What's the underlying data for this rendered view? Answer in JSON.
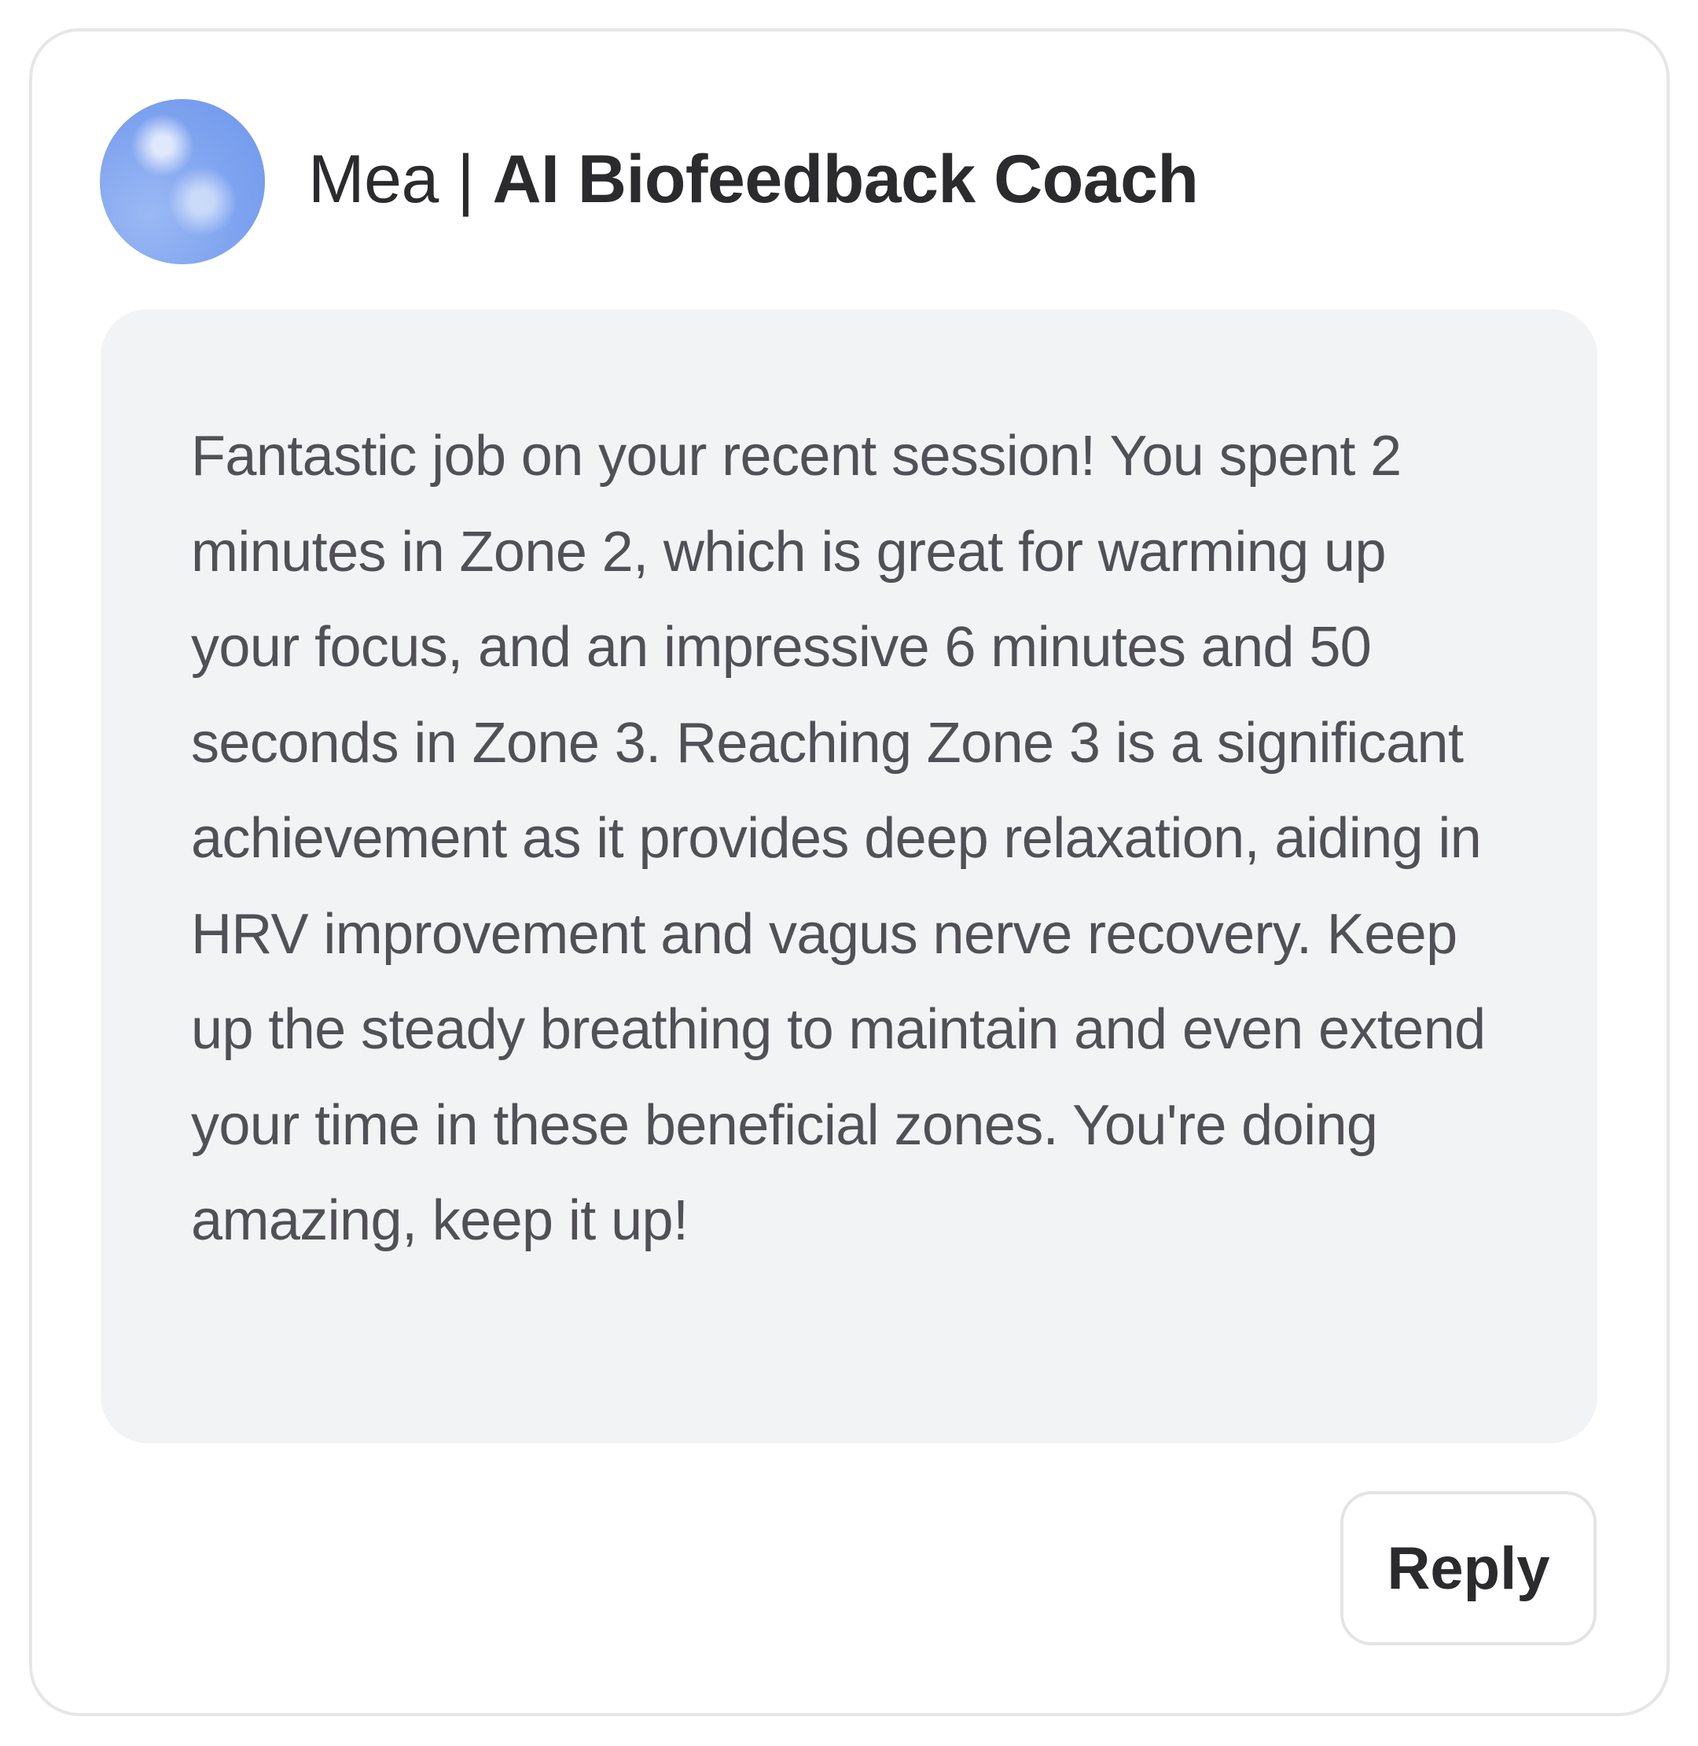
{
  "coach": {
    "name": "Mea",
    "separator": "|",
    "role": "AI Biofeedback Coach",
    "avatar_icon": "coach-avatar-gradient-orb"
  },
  "message": {
    "text": "Fantastic job on your recent session! You spent 2 minutes in Zone 2, which is great for warming up your focus, and an impressive 6 minutes and 50 seconds in Zone 3. Reaching Zone 3 is a significant achievement as it provides deep relaxation, aiding in HRV improvement and vagus nerve recovery. Keep up the steady breathing to maintain and even extend your time in these beneficial zones. You're doing amazing, keep it up!"
  },
  "actions": {
    "reply_label": "Reply"
  },
  "colors": {
    "card_border": "#e6e6e8",
    "bubble_background": "#f2f3f5",
    "heading_text": "#2b2b2e",
    "body_text": "#505056",
    "avatar_blue": "#7ea3ef"
  }
}
